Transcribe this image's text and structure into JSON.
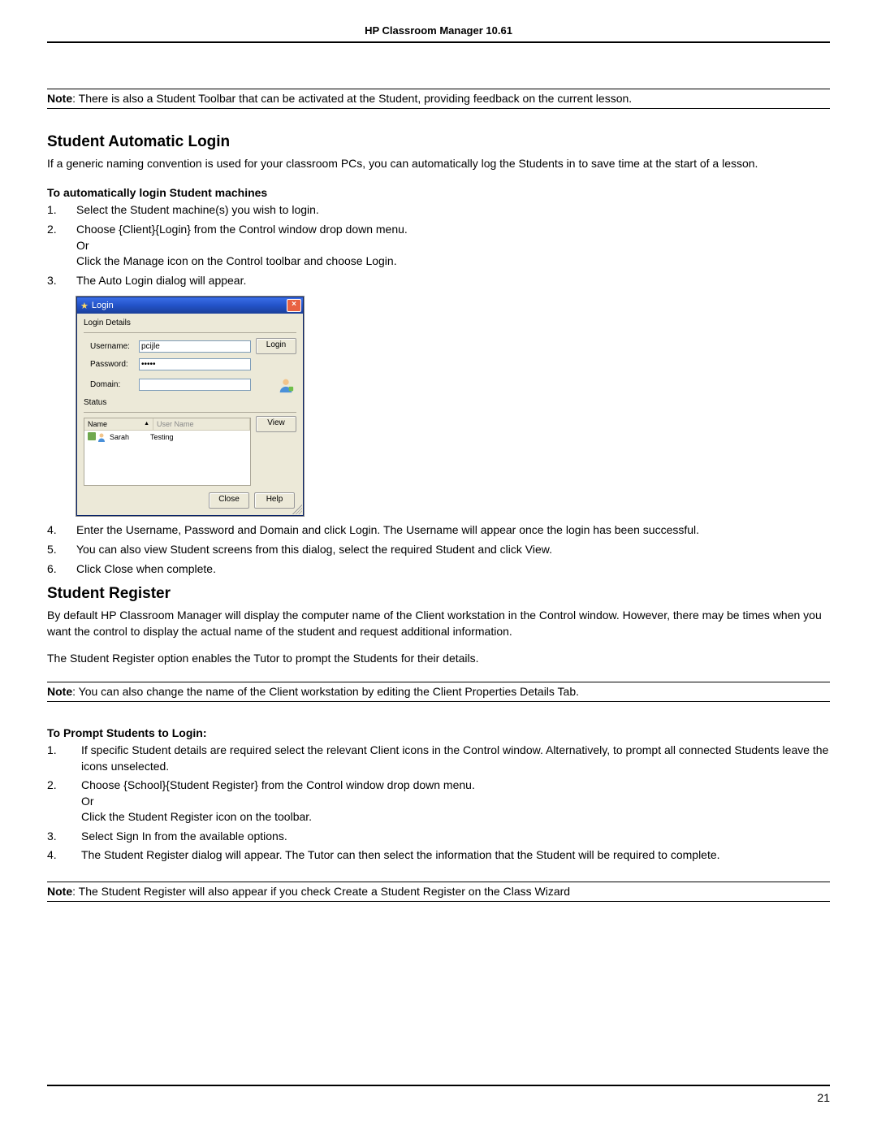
{
  "header": {
    "title": "HP Classroom Manager 10.61"
  },
  "note1": {
    "label": "Note",
    "text": ": There is also a Student Toolbar that can be activated at the Student, providing feedback on the current lesson."
  },
  "section1": {
    "heading": "Student Automatic Login",
    "intro": "If a generic naming convention is used for your classroom PCs, you can automatically log the Students in to save time at the start of a lesson.",
    "subhead": "To automatically login Student machines",
    "steps": {
      "s1": "Select the Student machine(s) you wish to login.",
      "s2a": "Choose {Client}{Login} from the Control window drop down menu.",
      "s2b": "Or",
      "s2c": "Click the Manage icon on the Control toolbar and choose Login.",
      "s3": "The Auto Login dialog will appear.",
      "s4": "Enter the Username, Password and Domain and click Login. The Username will appear once the login has been successful.",
      "s5": "You can also view Student screens from this dialog, select the required Student and click View.",
      "s6": "Click Close when complete."
    }
  },
  "dialog": {
    "title": "Login",
    "group1": "Login Details",
    "username_lbl": "Username:",
    "username_val": "pcijle",
    "password_lbl": "Password:",
    "password_val": "•••••",
    "domain_lbl": "Domain:",
    "domain_val": "",
    "login_btn": "Login",
    "group2": "Status",
    "col_name": "Name",
    "col_user": "User Name",
    "view_btn": "View",
    "row_name": "Sarah",
    "row_user": "Testing",
    "close_btn": "Close",
    "help_btn": "Help"
  },
  "section2": {
    "heading": "Student Register",
    "p1": "By default HP Classroom Manager will display the computer name of the Client workstation in the Control window. However, there may be times when you want the control to display the actual name of the student and request additional information.",
    "p2": "The Student Register option enables the Tutor to prompt the Students for their details.",
    "subhead": "To Prompt Students to Login:",
    "steps": {
      "s1": "If specific Student details are required select the relevant Client icons in the Control window. Alternatively, to prompt all connected Students leave the icons unselected.",
      "s2a": "Choose {School}{Student Register} from the Control window drop down menu.",
      "s2b": "Or",
      "s2c": "Click the Student Register icon on the toolbar.",
      "s3": "Select Sign In from the available options.",
      "s4": "The Student Register dialog will appear. The Tutor can then select the information that the Student will be required to complete."
    }
  },
  "note2": {
    "label": "Note",
    "text": ": You can also change the name of the Client workstation by editing the Client Properties Details Tab."
  },
  "note3": {
    "label": "Note",
    "text": ": The Student Register will also appear if you check Create a Student Register on the Class Wizard"
  },
  "page_number": "21"
}
